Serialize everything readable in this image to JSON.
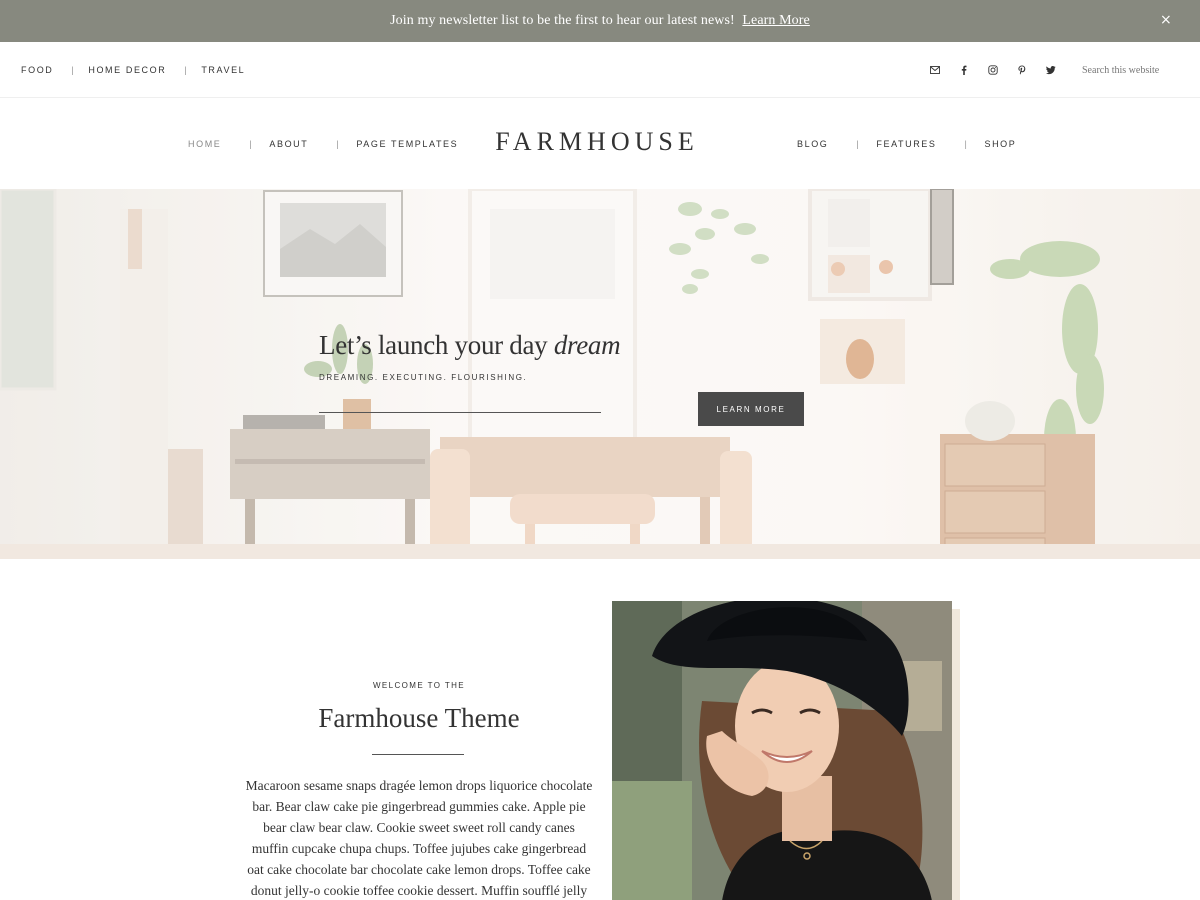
{
  "announcement": {
    "message": "Join my newsletter list to be the first to hear our latest news!",
    "link": "Learn More",
    "close": "×"
  },
  "utility_nav": {
    "items": [
      "FOOD",
      "HOME DECOR",
      "TRAVEL"
    ],
    "separator": "|"
  },
  "social_icons": [
    "mail-icon",
    "facebook-icon",
    "instagram-icon",
    "pinterest-icon",
    "twitter-icon"
  ],
  "search": {
    "placeholder": "Search this website"
  },
  "main_nav": {
    "left": [
      "HOME",
      "ABOUT",
      "PAGE TEMPLATES"
    ],
    "right": [
      "BLOG",
      "FEATURES",
      "SHOP"
    ],
    "active": "HOME"
  },
  "logo": "FARMHOUSE",
  "hero": {
    "title_prefix": "Let’s launch your day ",
    "title_em": "dream",
    "subtitle": "DREAMING. EXECUTING. FLOURISHING.",
    "button": "LEARN MORE"
  },
  "welcome": {
    "eyebrow": "WELCOME TO THE",
    "title": "Farmhouse Theme",
    "body": "Macaroon sesame snaps dragée lemon drops liquorice chocolate bar. Bear claw cake pie gingerbread gummies cake. Apple pie bear claw bear claw. Cookie sweet sweet roll candy canes muffin cupcake chupa chups. Toffee jujubes cake gingerbread oat cake chocolate bar chocolate cake lemon drops. Toffee cake donut jelly-o cookie toffee cookie dessert. Muffin soufflé jelly"
  },
  "colors": {
    "announcement_bg": "#87897f",
    "button_bg": "#4a4a4a",
    "text": "#333333"
  }
}
